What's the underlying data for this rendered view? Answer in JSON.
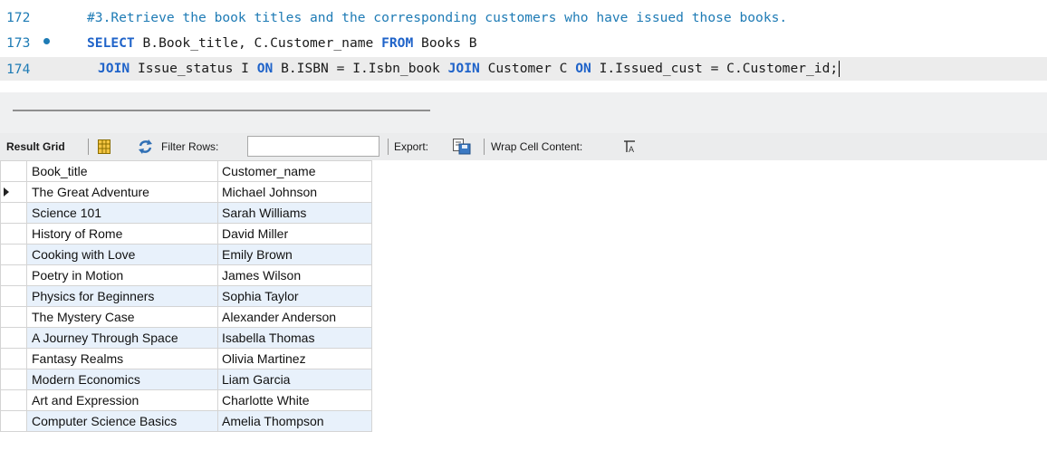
{
  "editor": {
    "lines": [
      {
        "number": "172",
        "comment": "#3.Retrieve the book titles and the corresponding customers who have issued those books."
      },
      {
        "number": "173",
        "kw1": "SELECT",
        "t1": " B.Book_title, C.Customer_name ",
        "kw2": "FROM",
        "t2": " Books B"
      },
      {
        "number": "174",
        "kw1": "JOIN",
        "t1": " Issue_status I ",
        "kw2": "ON",
        "t2": " B.ISBN = I.Isbn_book ",
        "kw3": "JOIN",
        "t3": " Customer C ",
        "kw4": "ON",
        "t4": " I.Issued_cust = C.Customer_id;"
      }
    ]
  },
  "toolbar": {
    "result_grid_label": "Result Grid",
    "filter_label": "Filter Rows:",
    "filter_value": "",
    "export_label": "Export:",
    "wrap_label": "Wrap Cell Content:"
  },
  "grid": {
    "columns": [
      "Book_title",
      "Customer_name"
    ],
    "rows": [
      [
        "The Great Adventure",
        "Michael Johnson"
      ],
      [
        "Science 101",
        "Sarah Williams"
      ],
      [
        "History of Rome",
        "David Miller"
      ],
      [
        "Cooking with Love",
        "Emily Brown"
      ],
      [
        "Poetry in Motion",
        "James Wilson"
      ],
      [
        "Physics for Beginners",
        "Sophia Taylor"
      ],
      [
        "The Mystery Case",
        "Alexander Anderson"
      ],
      [
        "A Journey Through Space",
        "Isabella Thomas"
      ],
      [
        "Fantasy Realms",
        "Olivia Martinez"
      ],
      [
        "Modern Economics",
        "Liam Garcia"
      ],
      [
        "Art and Expression",
        "Charlotte White"
      ],
      [
        "Computer Science Basics",
        "Amelia Thompson"
      ]
    ]
  },
  "colors": {
    "line_number": "#1e7bb5",
    "keyword": "#1f63c9",
    "alt_row": "#e8f1fb"
  }
}
